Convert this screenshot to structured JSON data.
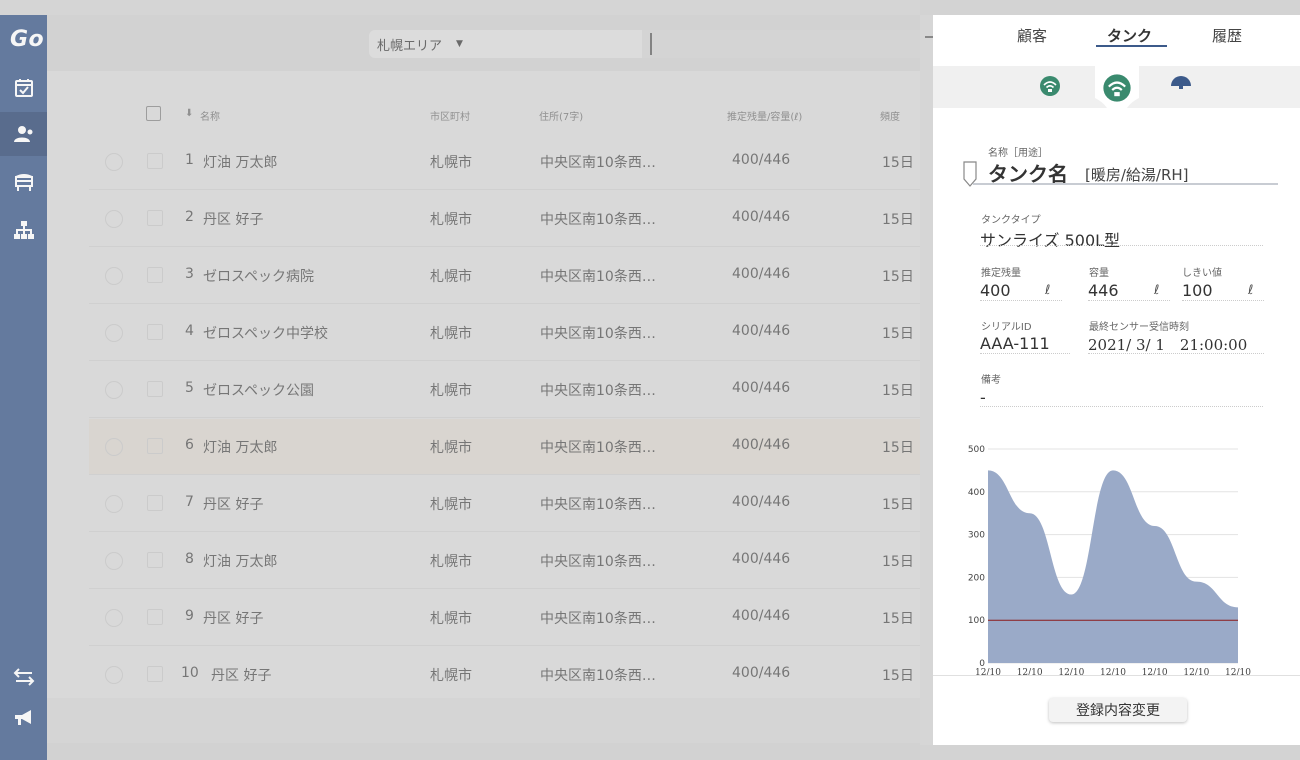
{
  "app": {
    "logo": "Go"
  },
  "sidebar": {
    "items": [
      {
        "icon": "calendar-check-icon"
      },
      {
        "icon": "customer-icon",
        "active": true
      },
      {
        "icon": "tank-icon"
      },
      {
        "icon": "org-chart-icon"
      }
    ],
    "bottom_items": [
      {
        "icon": "swap-icon"
      },
      {
        "icon": "megaphone-icon"
      }
    ]
  },
  "filter": {
    "area_label": "札幌エリア",
    "caret": "▼"
  },
  "table": {
    "headers": {
      "name": "名称",
      "city": "市区町村",
      "address": "住所(7字)",
      "amount": "推定残量/容量(ℓ)",
      "frequency": "頻度"
    },
    "sort_arrow": "⬇",
    "rows": [
      {
        "no": "1",
        "name": "灯油 万太郎",
        "city": "札幌市",
        "address": "中央区南10条西…",
        "amount": "400/446",
        "frequency": "15日"
      },
      {
        "no": "2",
        "name": "丹区 好子",
        "city": "札幌市",
        "address": "中央区南10条西…",
        "amount": "400/446",
        "frequency": "15日"
      },
      {
        "no": "3",
        "name": "ゼロスペック病院",
        "city": "札幌市",
        "address": "中央区南10条西…",
        "amount": "400/446",
        "frequency": "15日"
      },
      {
        "no": "4",
        "name": "ゼロスペック中学校",
        "city": "札幌市",
        "address": "中央区南10条西…",
        "amount": "400/446",
        "frequency": "15日"
      },
      {
        "no": "5",
        "name": "ゼロスペック公園",
        "city": "札幌市",
        "address": "中央区南10条西…",
        "amount": "400/446",
        "frequency": "15日"
      },
      {
        "no": "6",
        "name": "灯油 万太郎",
        "city": "札幌市",
        "address": "中央区南10条西…",
        "amount": "400/446",
        "frequency": "15日",
        "highlight": true
      },
      {
        "no": "7",
        "name": "丹区 好子",
        "city": "札幌市",
        "address": "中央区南10条西…",
        "amount": "400/446",
        "frequency": "15日"
      },
      {
        "no": "8",
        "name": "灯油 万太郎",
        "city": "札幌市",
        "address": "中央区南10条西…",
        "amount": "400/446",
        "frequency": "15日"
      },
      {
        "no": "9",
        "name": "丹区 好子",
        "city": "札幌市",
        "address": "中央区南10条西…",
        "amount": "400/446",
        "frequency": "15日"
      },
      {
        "no": "10",
        "name": "丹区 好子",
        "city": "札幌市",
        "address": "中央区南10条西…",
        "amount": "400/446",
        "frequency": "15日"
      }
    ]
  },
  "panel": {
    "tabs": [
      {
        "label": "顧客"
      },
      {
        "label": "タンク",
        "active": true
      },
      {
        "label": "履歴"
      }
    ],
    "sensors": [
      {
        "icon": "signal-icon",
        "color": "#3a8a6e"
      },
      {
        "icon": "signal-icon",
        "color": "#3a8a6e",
        "active": true
      },
      {
        "icon": "signal-half-icon",
        "color": "#3c5a8a"
      }
    ],
    "name_label": "名称［用途］",
    "name_value": "タンク名",
    "name_usage": "[暖房/給湯/RH]",
    "tank_type_label": "タンクタイプ",
    "tank_type_value": "サンライズ 500L型",
    "estimated_label": "推定残量",
    "estimated_value": "400",
    "capacity_label": "容量",
    "capacity_value": "446",
    "threshold_label": "しきい値",
    "threshold_value": "100",
    "unit": "ℓ",
    "serial_label": "シリアルID",
    "serial_value": "AAA-111",
    "last_received_label": "最終センサー受信時刻",
    "last_received_value": "2021/ 3/ 1　21:00:00",
    "note_label": "備考",
    "note_value": "-",
    "edit_button": "登録内容変更"
  },
  "chart_data": {
    "type": "area",
    "x": [
      "12/10",
      "12/10",
      "12/10",
      "12/10",
      "12/10",
      "12/10",
      "12/10"
    ],
    "ylim": [
      0,
      500
    ],
    "yticks": [
      0,
      100,
      200,
      300,
      400,
      500
    ],
    "series": [
      {
        "values": [
          450,
          350,
          160,
          450,
          320,
          190,
          130
        ]
      }
    ],
    "threshold": 100,
    "colors": {
      "area": "#9aaac8",
      "threshold": "#8b1a1a"
    },
    "grid": true
  }
}
